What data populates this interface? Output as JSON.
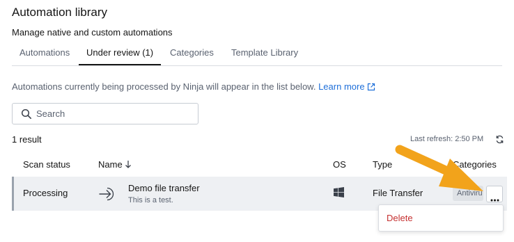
{
  "header": {
    "title": "Automation library",
    "subtitle": "Manage native and custom automations"
  },
  "tabs": [
    {
      "label": "Automations",
      "active": false
    },
    {
      "label": "Under review (1)",
      "active": true
    },
    {
      "label": "Categories",
      "active": false
    },
    {
      "label": "Template Library",
      "active": false
    }
  ],
  "info": {
    "text": "Automations currently being processed by Ninja will appear in the list below.",
    "link_label": "Learn more",
    "link_icon": "external-link-icon"
  },
  "search": {
    "placeholder": "Search",
    "value": "",
    "icon": "search-icon"
  },
  "results": {
    "count_label": "1 result",
    "last_refresh": "Last refresh: 2:50 PM",
    "refresh_icon": "refresh-icon"
  },
  "table": {
    "columns": [
      "Scan status",
      "Name",
      "OS",
      "Type",
      "Categories"
    ],
    "sort_column": "Name",
    "sort_icon": "arrow-down-icon",
    "rows": [
      {
        "scan_status": "Processing",
        "name": "Demo file transfer",
        "description": "This is a test.",
        "os_icon": "windows-icon",
        "type": "File Transfer",
        "category": "Antiviru"
      }
    ]
  },
  "row_menu": {
    "items": [
      {
        "label": "Delete"
      }
    ]
  },
  "colors": {
    "accent_link": "#1e6fd9",
    "danger": "#c53030",
    "annotation_arrow": "#f2a31b",
    "row_highlight": "#eef0f3"
  }
}
